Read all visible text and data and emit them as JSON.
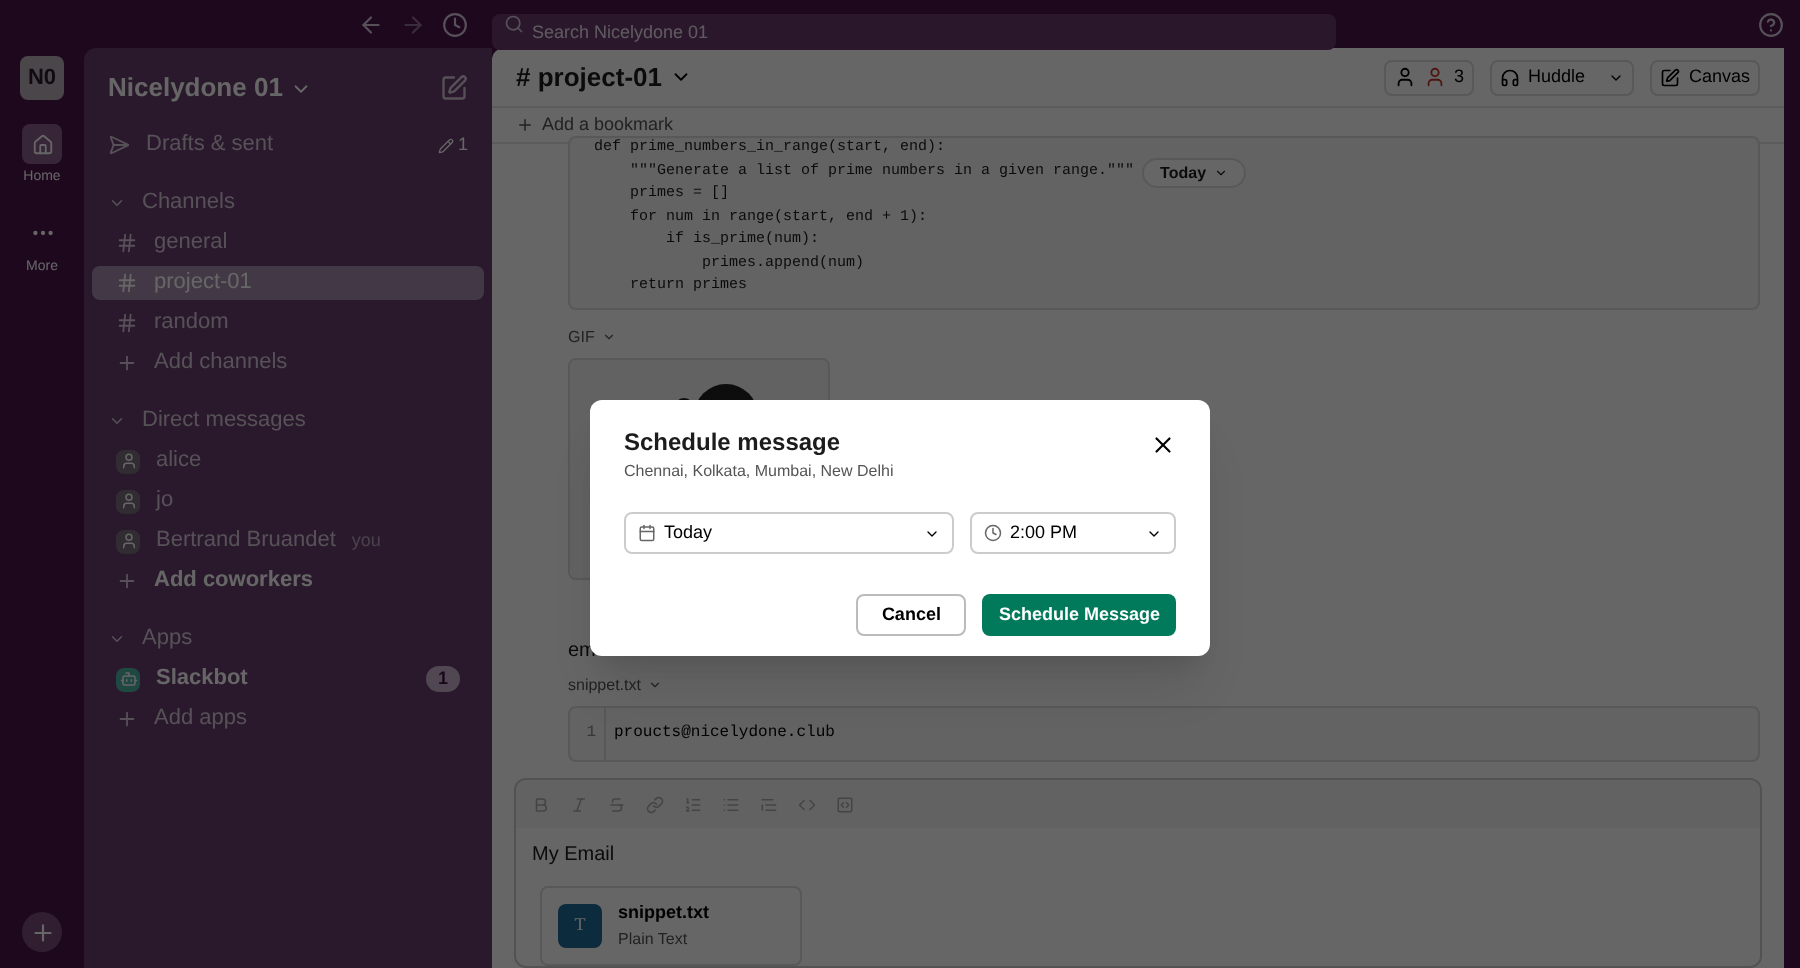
{
  "top_bar": {
    "search": {
      "placeholder": "Search Nicelydone 01"
    }
  },
  "rail": {
    "workspace": "N0",
    "items": [
      {
        "kind": "home",
        "label": "Home",
        "selected": true
      },
      {
        "kind": "more",
        "label": "More",
        "selected": false
      }
    ]
  },
  "sidebar": {
    "workspace": "Nicelydone 01",
    "drafts": {
      "label": "Drafts & sent",
      "count": "1"
    },
    "sections": [
      {
        "title": "Channels",
        "items": [
          {
            "kind": "channel",
            "label": "general",
            "selected": false
          },
          {
            "kind": "channel",
            "label": "project-01",
            "selected": true
          },
          {
            "kind": "channel",
            "label": "random",
            "selected": false
          },
          {
            "kind": "add",
            "label": "Add channels",
            "bold": false
          }
        ]
      },
      {
        "title": "Direct messages",
        "items": [
          {
            "kind": "person",
            "label": "alice"
          },
          {
            "kind": "person",
            "label": "jo"
          },
          {
            "kind": "person",
            "label": "Bertrand Bruandet",
            "note": "you"
          },
          {
            "kind": "add",
            "label": "Add coworkers",
            "bold": true
          }
        ]
      },
      {
        "title": "Apps",
        "items": [
          {
            "kind": "bot",
            "label": "Slackbot",
            "badge": "1"
          },
          {
            "kind": "add",
            "label": "Add apps",
            "bold": false
          }
        ]
      }
    ]
  },
  "channel": {
    "prefix": "#",
    "name": "project-01",
    "member_count": "3",
    "huddle": "Huddle",
    "canvas": "Canvas",
    "bookmark": "Add a bookmark"
  },
  "messages": {
    "code": [
      "def prime_numbers_in_range(start, end):",
      "    \"\"\"Generate a list of prime numbers in a given range.\"\"\"",
      "    primes = []",
      "    for num in range(start, end + 1):",
      "        if is_prime(num):",
      "            primes.append(num)",
      "    return primes"
    ],
    "date_pill": "Today",
    "gif_label": "GIF",
    "text": "em",
    "snippet_label": "snippet.txt",
    "snippet_lines": [
      {
        "number": "1",
        "text": "proucts@nicelydone.club"
      }
    ]
  },
  "composer": {
    "text": "My Email",
    "attachment": {
      "name": "snippet.txt",
      "type": "Plain Text",
      "icon": "T"
    }
  },
  "dialog": {
    "title": "Schedule message",
    "subtitle": "Chennai, Kolkata, Mumbai, New Delhi",
    "date": "Today",
    "time": "2:00 PM",
    "cancel": "Cancel",
    "confirm": "Schedule Message"
  }
}
